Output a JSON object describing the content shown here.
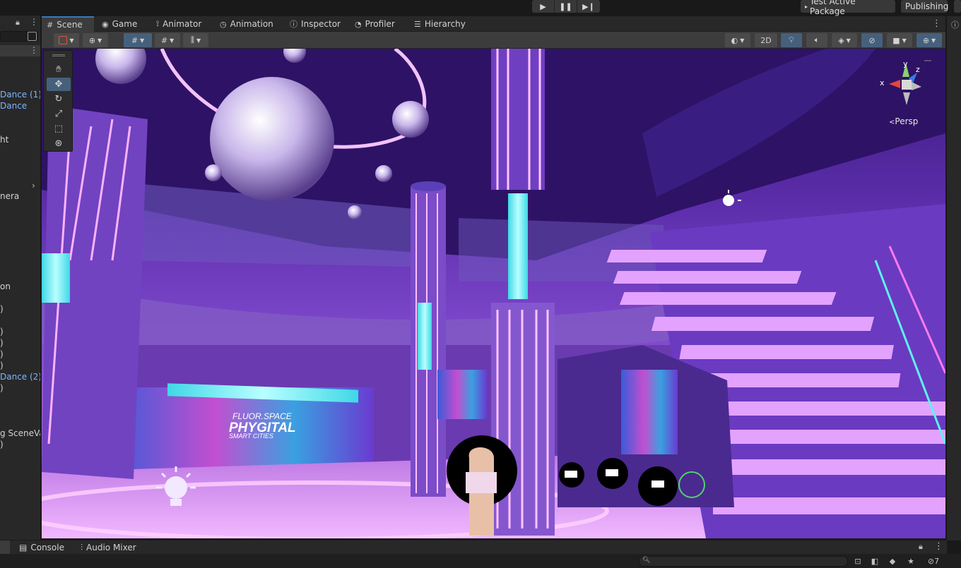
{
  "playbar": {
    "play_icon": "play-icon",
    "pause_icon": "pause-icon",
    "step_icon": "step-icon"
  },
  "top_right": {
    "package_label": "Test Active Package",
    "publishing_label": "Publishing"
  },
  "hierarchy": {
    "items": [
      "Dance (1)",
      "Dance",
      "ht",
      "nera",
      "on",
      ")",
      ")",
      ")",
      ")",
      ")",
      "Dance (2)",
      ")",
      "g SceneVa",
      ")"
    ]
  },
  "tabs": [
    {
      "label": "Scene",
      "icon": "#"
    },
    {
      "label": "Game",
      "icon": "◉"
    },
    {
      "label": "Animator",
      "icon": "⟟"
    },
    {
      "label": "Animation",
      "icon": "◷"
    },
    {
      "label": "Inspector",
      "icon": "ⓘ"
    },
    {
      "label": "Profiler",
      "icon": "◔"
    },
    {
      "label": "Hierarchy",
      "icon": "☰"
    }
  ],
  "scene_toolbar": {
    "mode_2d": "2D"
  },
  "viewport": {
    "signage_line1": "FLUOR.SPACE",
    "signage_line2": "PHYGITAL",
    "signage_line3": "SMART CITIES",
    "persp_label": "Persp",
    "gizmo_x": "x",
    "gizmo_y": "y",
    "gizmo_z": "z"
  },
  "bottom_tabs": [
    {
      "label": "Console",
      "icon": "▤"
    },
    {
      "label": "Audio Mixer",
      "icon": "⫶"
    }
  ],
  "status": {
    "badge_count": "7"
  },
  "colors": {
    "accent": "#3a79bb",
    "selected_button": "#46607c",
    "hierarchy_link": "#7fb5ff",
    "neon_pink": "#ff7af2",
    "neon_cyan": "#5ff2f0"
  }
}
